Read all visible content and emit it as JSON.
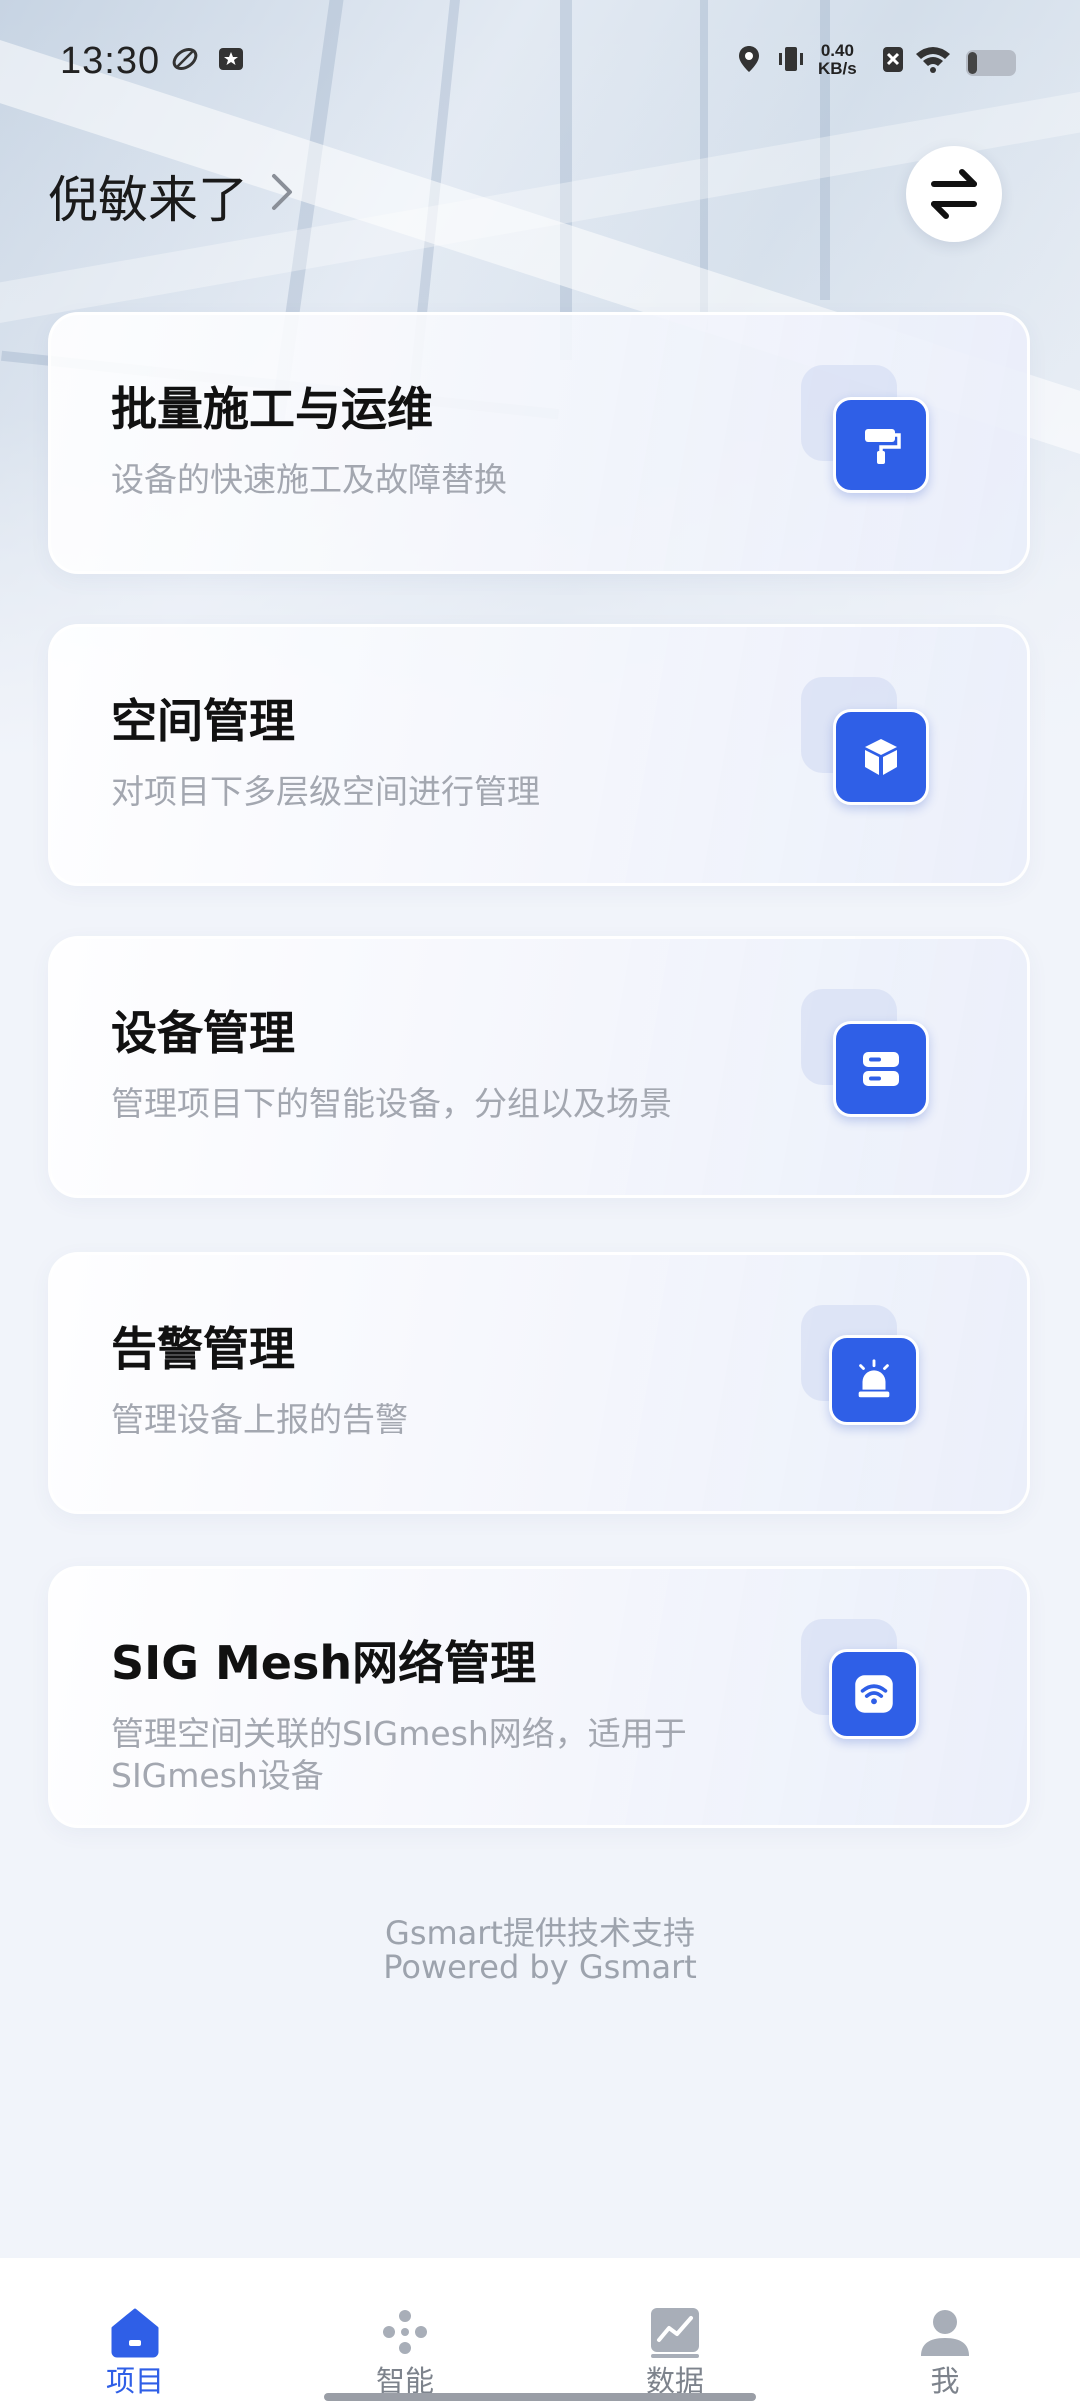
{
  "status_bar": {
    "time": "13:30",
    "net_speed_value": "0.40",
    "net_speed_unit": "KB/s",
    "battery_level": 0.2
  },
  "header": {
    "project_name": "倪敏来了",
    "switch_icon": "swap-arrows-icon"
  },
  "cards": [
    {
      "title": "批量施工与运维",
      "description": "设备的快速施工及故障替换",
      "icon": "paint-roller-icon"
    },
    {
      "title": "空间管理",
      "description": "对项目下多层级空间进行管理",
      "icon": "cube-icon"
    },
    {
      "title": "设备管理",
      "description": "管理项目下的智能设备，分组以及场景",
      "icon": "server-icon"
    },
    {
      "title": "告警管理",
      "description": "管理设备上报的告警",
      "icon": "alarm-light-icon"
    },
    {
      "title": "SIG Mesh网络管理",
      "description": "管理空间关联的SIGmesh网络，适用于SIGmesh设备",
      "icon": "wifi-router-icon"
    }
  ],
  "footer": {
    "credit_cn": "Gsmart提供技术支持",
    "credit_en": "Powered by Gsmart"
  },
  "nav": {
    "items": [
      {
        "label": "项目",
        "icon": "home-icon",
        "active": true
      },
      {
        "label": "智能",
        "icon": "dots-icon",
        "active": false
      },
      {
        "label": "数据",
        "icon": "chart-icon",
        "active": false
      },
      {
        "label": "我",
        "icon": "person-icon",
        "active": false
      }
    ]
  },
  "colors": {
    "accent": "#2f5fe7",
    "muted_text": "#a3a7b0",
    "background": "#f1f4fa"
  }
}
